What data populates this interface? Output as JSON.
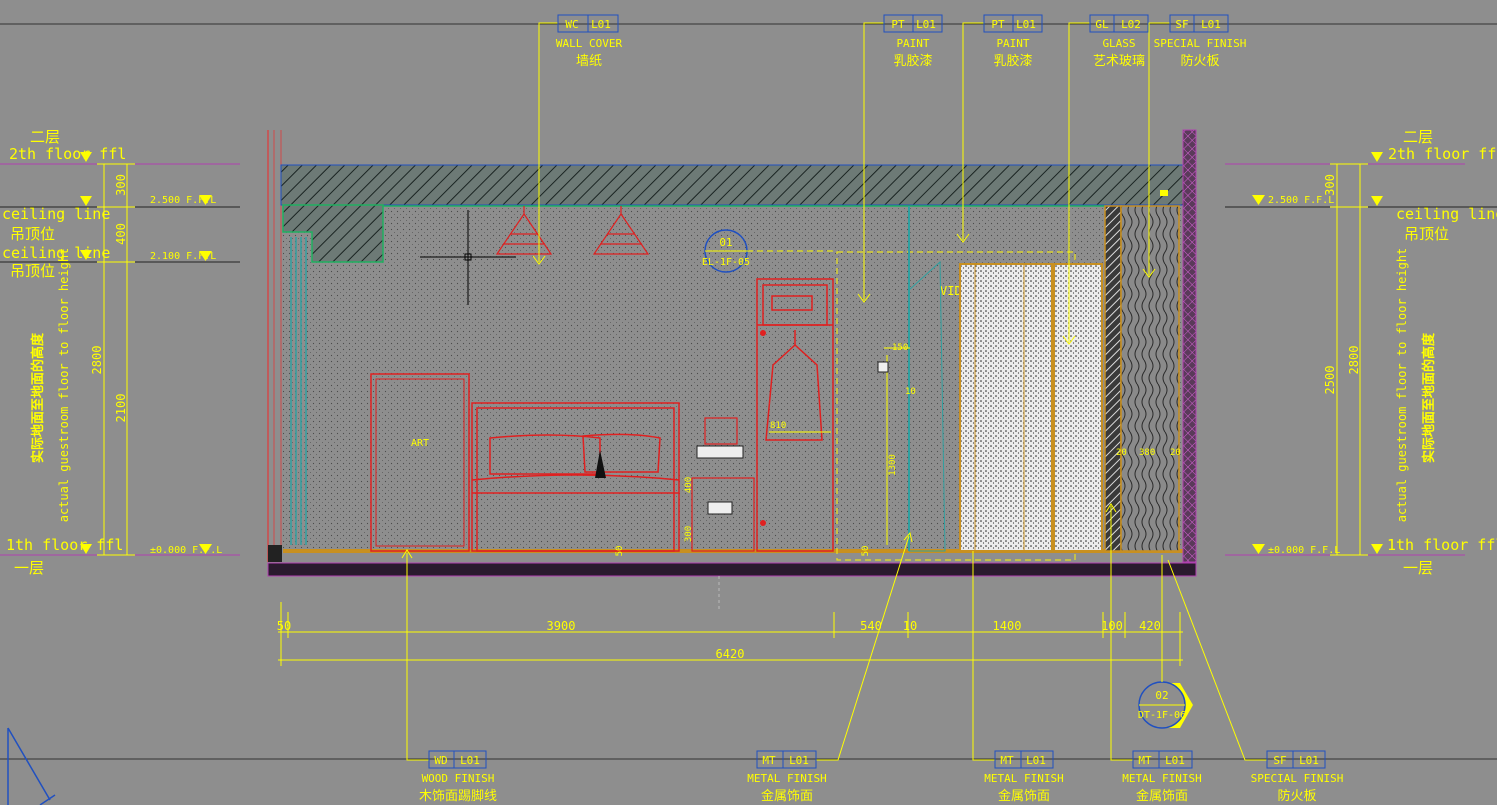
{
  "tags_top": [
    {
      "code": "WC",
      "num": "L01",
      "en": "WALL COVER",
      "cn": "墙纸"
    },
    {
      "code": "PT",
      "num": "L01",
      "en": "PAINT",
      "cn": "乳胶漆"
    },
    {
      "code": "PT",
      "num": "L01",
      "en": "PAINT",
      "cn": "乳胶漆"
    },
    {
      "code": "GL",
      "num": "L02",
      "en": "GLASS",
      "cn": "艺术玻璃"
    },
    {
      "code": "SF",
      "num": "L01",
      "en": "SPECIAL FINISH",
      "cn": "防火板"
    }
  ],
  "tags_bottom": [
    {
      "code": "WD",
      "num": "L01",
      "en": "WOOD FINISH",
      "cn": "木饰面踢脚线"
    },
    {
      "code": "MT",
      "num": "L01",
      "en": "METAL FINISH",
      "cn": "金属饰面"
    },
    {
      "code": "MT",
      "num": "L01",
      "en": "METAL FINISH",
      "cn": "金属饰面"
    },
    {
      "code": "MT",
      "num": "L01",
      "en": "METAL FINISH",
      "cn": "金属饰面"
    },
    {
      "code": "SF",
      "num": "L01",
      "en": "SPECIAL FINISH",
      "cn": "防火板"
    }
  ],
  "left_levels": {
    "floor2_cn": "二层",
    "floor2_en": "2th floor ffl",
    "ceil_en_1": "ceiling line",
    "ceil_cn_1": "吊顶位",
    "ceil_en_2": "ceiling line",
    "ceil_cn_2": "吊顶位",
    "floor1_en": "1th floor ffl",
    "floor1_cn": "一层",
    "ffl_2500": "2.500 F.F.L",
    "ffl_2100": "2.100 F.F.L",
    "ffl_000": "±0.000 F.F.L",
    "v_cn": "实际地面至地面的高度",
    "v_en": "actual guestroom floor to floor height",
    "d300": "300",
    "d400": "400",
    "d2800": "2800",
    "d2100": "2100"
  },
  "right_levels": {
    "floor2_cn": "二层",
    "floor2_en": "2th floor ff",
    "ceil_en": "ceiling line",
    "ceil_cn": "吊顶位",
    "floor1_en": "1th floor ffl",
    "floor1_cn": "一层",
    "ffl_2500": "2.500 F.F.L",
    "ffl_000": "±0.000 F.F.L",
    "v_cn": "实际地面至地面的高度",
    "v_en": "actual guestroom floor to floor height",
    "d300": "300",
    "d2500": "2500",
    "d2800": "2800"
  },
  "dims_bottom": {
    "d50": "50",
    "d3900": "3900",
    "d540": "540",
    "d10": "10",
    "d1400": "1400",
    "d100": "100",
    "d420": "420",
    "total": "6420"
  },
  "room_labels": {
    "art": "ART",
    "video": "VIDO",
    "d810": "810",
    "d150": "150",
    "d10": "10",
    "d1300": "1300",
    "d400": "400",
    "d300": "300",
    "d50a": "50",
    "d50b": "50",
    "d20a": "20",
    "d380": "380",
    "d20b": "20"
  },
  "markers": {
    "m1_top": "01",
    "m1_bot": "EL-1F-05",
    "m2_top": "02",
    "m2_bot": "DT-1F-06"
  }
}
